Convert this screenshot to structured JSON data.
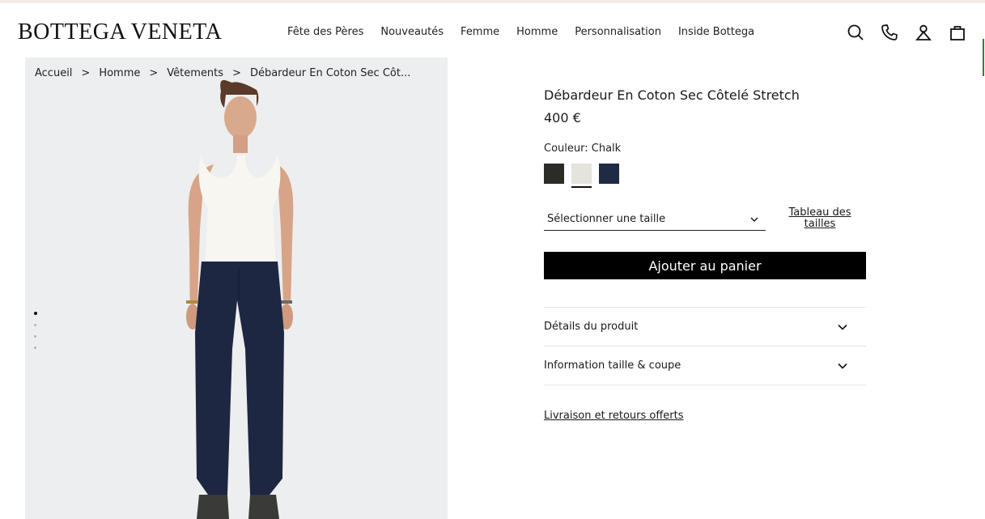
{
  "brand": {
    "logo_text": "BOTTEGA VENETA"
  },
  "nav": {
    "items": [
      "Fête des Pères",
      "Nouveautés",
      "Femme",
      "Homme",
      "Personnalisation",
      "Inside Bottega"
    ]
  },
  "header_icons": [
    "search-icon",
    "phone-icon",
    "account-icon",
    "bag-icon"
  ],
  "breadcrumb": {
    "items": [
      "Accueil",
      "Homme",
      "Vêtements",
      "Débardeur En Coton Sec Côt..."
    ],
    "separator": ">"
  },
  "gallery": {
    "image_count": 4,
    "active_index": 0
  },
  "product": {
    "title": "Débardeur En Coton Sec Côtelé Stretch",
    "price": "400 €",
    "color_label": "Couleur: Chalk",
    "swatches": [
      {
        "name": "dark",
        "color": "#2b2c28"
      },
      {
        "name": "chalk",
        "color": "#e4e3dc",
        "selected": true
      },
      {
        "name": "navy",
        "color": "#1f2a44"
      }
    ],
    "size_select": {
      "selected_label": "Sélectionner une taille"
    },
    "size_guide": {
      "line1": "Tableau des",
      "line2": "tailles"
    },
    "add_to_cart": "Ajouter au panier",
    "accordion": [
      {
        "label": "Détails du produit"
      },
      {
        "label": "Information taille & coupe"
      }
    ],
    "shipping_link": "Livraison et retours offerts"
  },
  "colors": {
    "accent": "#000000",
    "image_bg": "#edeeef"
  }
}
